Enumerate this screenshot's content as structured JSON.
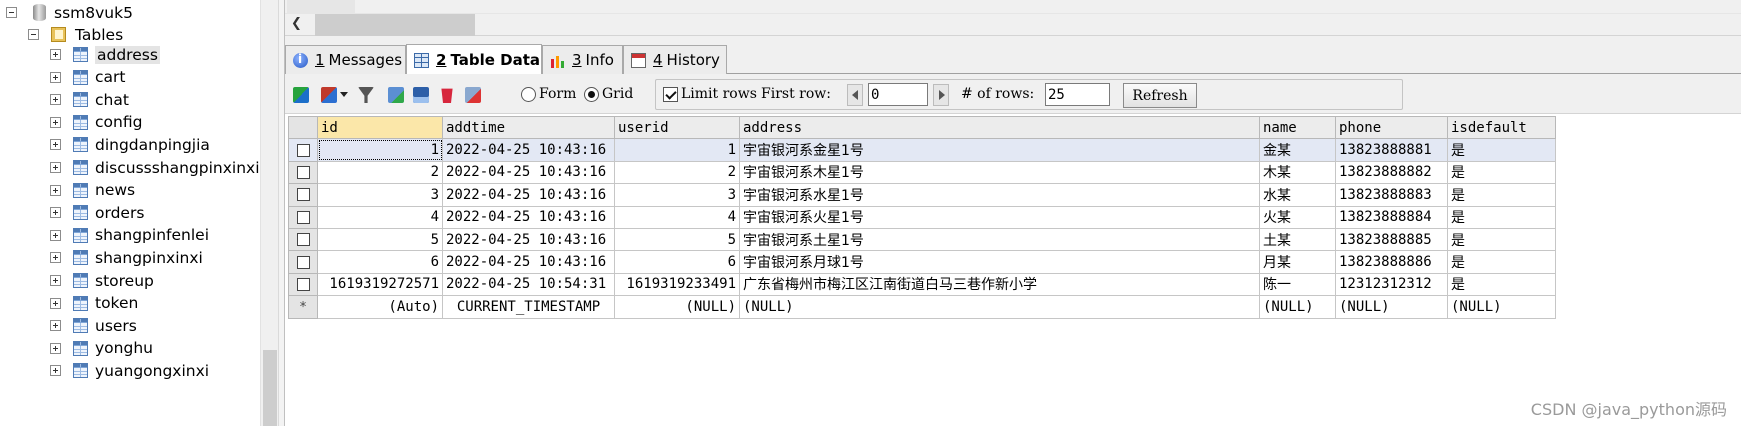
{
  "tree": {
    "database": "ssm8vuk5",
    "tables_folder": "Tables",
    "selected_table": "address",
    "tables": [
      "address",
      "cart",
      "chat",
      "config",
      "dingdanpingjia",
      "discussshangpinxinxi",
      "news",
      "orders",
      "shangpinfenlei",
      "shangpinxinxi",
      "storeup",
      "token",
      "users",
      "yonghu",
      "yuangongxinxi"
    ]
  },
  "tabs": [
    {
      "num": "1",
      "label": " Messages",
      "icon": "info-icon"
    },
    {
      "num": "2",
      "label": " Table Data",
      "icon": "grid-icon"
    },
    {
      "num": "3",
      "label": " Info",
      "icon": "bar-chart-icon"
    },
    {
      "num": "4",
      "label": " History",
      "icon": "calendar-icon"
    }
  ],
  "toolbar": {
    "form_label": "Form",
    "grid_label": "Grid",
    "limit_rows_label": "Limit rows",
    "first_row_label": "First row:",
    "first_row_value": "0",
    "rows_label": "# of rows:",
    "rows_value": "25",
    "refresh_label": "Refresh"
  },
  "grid": {
    "columns": [
      "id",
      "addtime",
      "userid",
      "address",
      "name",
      "phone",
      "isdefault"
    ],
    "rows": [
      [
        "1",
        "2022-04-25 10:43:16",
        "1",
        "宇宙银河系金星1号",
        "金某",
        "13823888881",
        "是"
      ],
      [
        "2",
        "2022-04-25 10:43:16",
        "2",
        "宇宙银河系木星1号",
        "木某",
        "13823888882",
        "是"
      ],
      [
        "3",
        "2022-04-25 10:43:16",
        "3",
        "宇宙银河系水星1号",
        "水某",
        "13823888883",
        "是"
      ],
      [
        "4",
        "2022-04-25 10:43:16",
        "4",
        "宇宙银河系火星1号",
        "火某",
        "13823888884",
        "是"
      ],
      [
        "5",
        "2022-04-25 10:43:16",
        "5",
        "宇宙银河系土星1号",
        "土某",
        "13823888885",
        "是"
      ],
      [
        "6",
        "2022-04-25 10:43:16",
        "6",
        "宇宙银河系月球1号",
        "月某",
        "13823888886",
        "是"
      ],
      [
        "1619319272571",
        "2022-04-25 10:54:31",
        "1619319233491",
        "广东省梅州市梅江区江南街道白马三巷作新小学",
        "陈一",
        "12312312312",
        "是"
      ]
    ],
    "new_row_marker": "*",
    "new_row": [
      "(Auto)",
      "CURRENT_TIMESTAMP",
      "(NULL)",
      "(NULL)",
      "(NULL)",
      "(NULL)",
      "(NULL)"
    ]
  },
  "watermark": "CSDN @java_python源码"
}
